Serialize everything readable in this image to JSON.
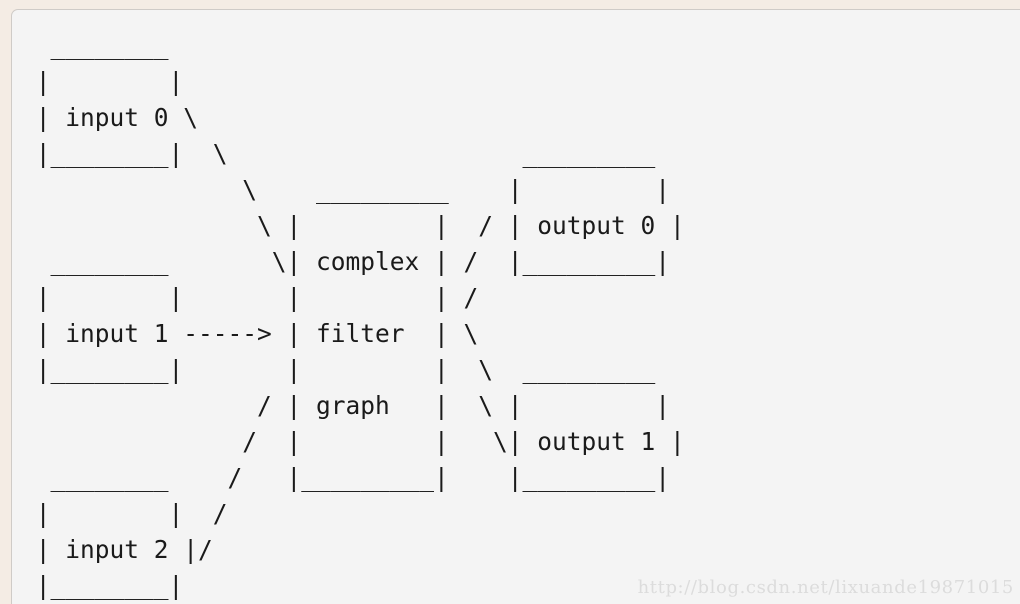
{
  "page": {
    "background_color": "#f4ece4",
    "panel_color": "#f4f4f4",
    "panel_border_color": "#cfcbc7",
    "text_color": "#1a1a1a"
  },
  "diagram": {
    "type": "ascii-dataflow-diagram",
    "title": "complex filter graph",
    "nodes": [
      {
        "id": "input0",
        "label": "input 0",
        "role": "source"
      },
      {
        "id": "input1",
        "label": "input 1",
        "role": "source"
      },
      {
        "id": "input2",
        "label": "input 2",
        "role": "source"
      },
      {
        "id": "filter",
        "label": "complex filter graph",
        "role": "processor",
        "label_lines": [
          "complex",
          "filter",
          "graph"
        ]
      },
      {
        "id": "output0",
        "label": "output 0",
        "role": "sink"
      },
      {
        "id": "output1",
        "label": "output 1",
        "role": "sink"
      }
    ],
    "edges": [
      {
        "from": "input0",
        "to": "filter",
        "style": "diagonal"
      },
      {
        "from": "input1",
        "to": "filter",
        "style": "arrow",
        "glyph": "----->"
      },
      {
        "from": "input2",
        "to": "filter",
        "style": "diagonal"
      },
      {
        "from": "filter",
        "to": "output0",
        "style": "diagonal"
      },
      {
        "from": "filter",
        "to": "output1",
        "style": "diagonal"
      }
    ],
    "art": " _________\n|         |\n| input 0 |\\\n|_________| \\          _________\n             \\  _________     /| output 0 |\n              \\ |         |  / |_________|\n _________     \\| complex | /\n|         |     |         |/\n| input 1 |---->| filter  |\\\n|_________|     |         | \\  _________\n             /| graph   |  \\ |         |\n            / |         |   \\| output 1 |\n _________ /  |_________|    |_________|\n|         | /\n| input 2 |/\n|_________|",
    "lines": [
      " _________",
      "|         |",
      "| input 0 |\\",
      "|_________| \\",
      "             \\  _________     /| output 0 |",
      "              \\ |         |  / |_________|",
      " _________     \\| complex | /",
      "|         |     |         |/",
      "| input 1 |---->| filter  |\\",
      "|_________|     |         | \\",
      "             /| graph   |  \\ |         |",
      "            / |         |   \\| output 1 |",
      " _________ /  |_________|    |_________|",
      "|         | /",
      "| input 2 |/",
      "|_________|"
    ]
  },
  "watermark": {
    "text": "http://blog.csdn.net/lixuande19871015",
    "color": "#dcdcdc"
  }
}
